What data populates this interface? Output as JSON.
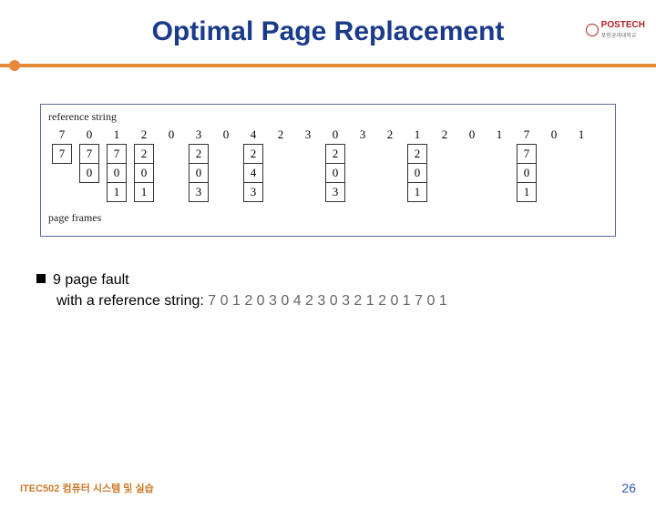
{
  "logo": {
    "text": "POSTECH",
    "sub": "포항공과대학교"
  },
  "title": "Optimal Page Replacement",
  "diagram": {
    "ref_label": "reference string",
    "frames_label": "page frames",
    "ref": [
      "7",
      "0",
      "1",
      "2",
      "0",
      "3",
      "0",
      "4",
      "2",
      "3",
      "0",
      "3",
      "2",
      "1",
      "2",
      "0",
      "1",
      "7",
      "0",
      "1"
    ],
    "columns": [
      {
        "idx": 0,
        "cells": [
          "7"
        ]
      },
      {
        "idx": 1,
        "cells": [
          "7",
          "0"
        ]
      },
      {
        "idx": 2,
        "cells": [
          "7",
          "0",
          "1"
        ]
      },
      {
        "idx": 3,
        "cells": [
          "2",
          "0",
          "1"
        ]
      },
      {
        "idx": 5,
        "cells": [
          "2",
          "0",
          "3"
        ]
      },
      {
        "idx": 7,
        "cells": [
          "2",
          "4",
          "3"
        ]
      },
      {
        "idx": 10,
        "cells": [
          "2",
          "0",
          "3"
        ]
      },
      {
        "idx": 13,
        "cells": [
          "2",
          "0",
          "1"
        ]
      },
      {
        "idx": 17,
        "cells": [
          "7",
          "0",
          "1"
        ]
      }
    ]
  },
  "bullet": {
    "line1": "9 page fault",
    "line2a": "with a reference string: ",
    "line2b": "7 0 1 2 0 3 0 4 2 3 0 3 2 1 2 0 1 7 0 1"
  },
  "footer": {
    "course": "ITEC502 컴퓨터 시스템 및 실습",
    "page": "26"
  }
}
